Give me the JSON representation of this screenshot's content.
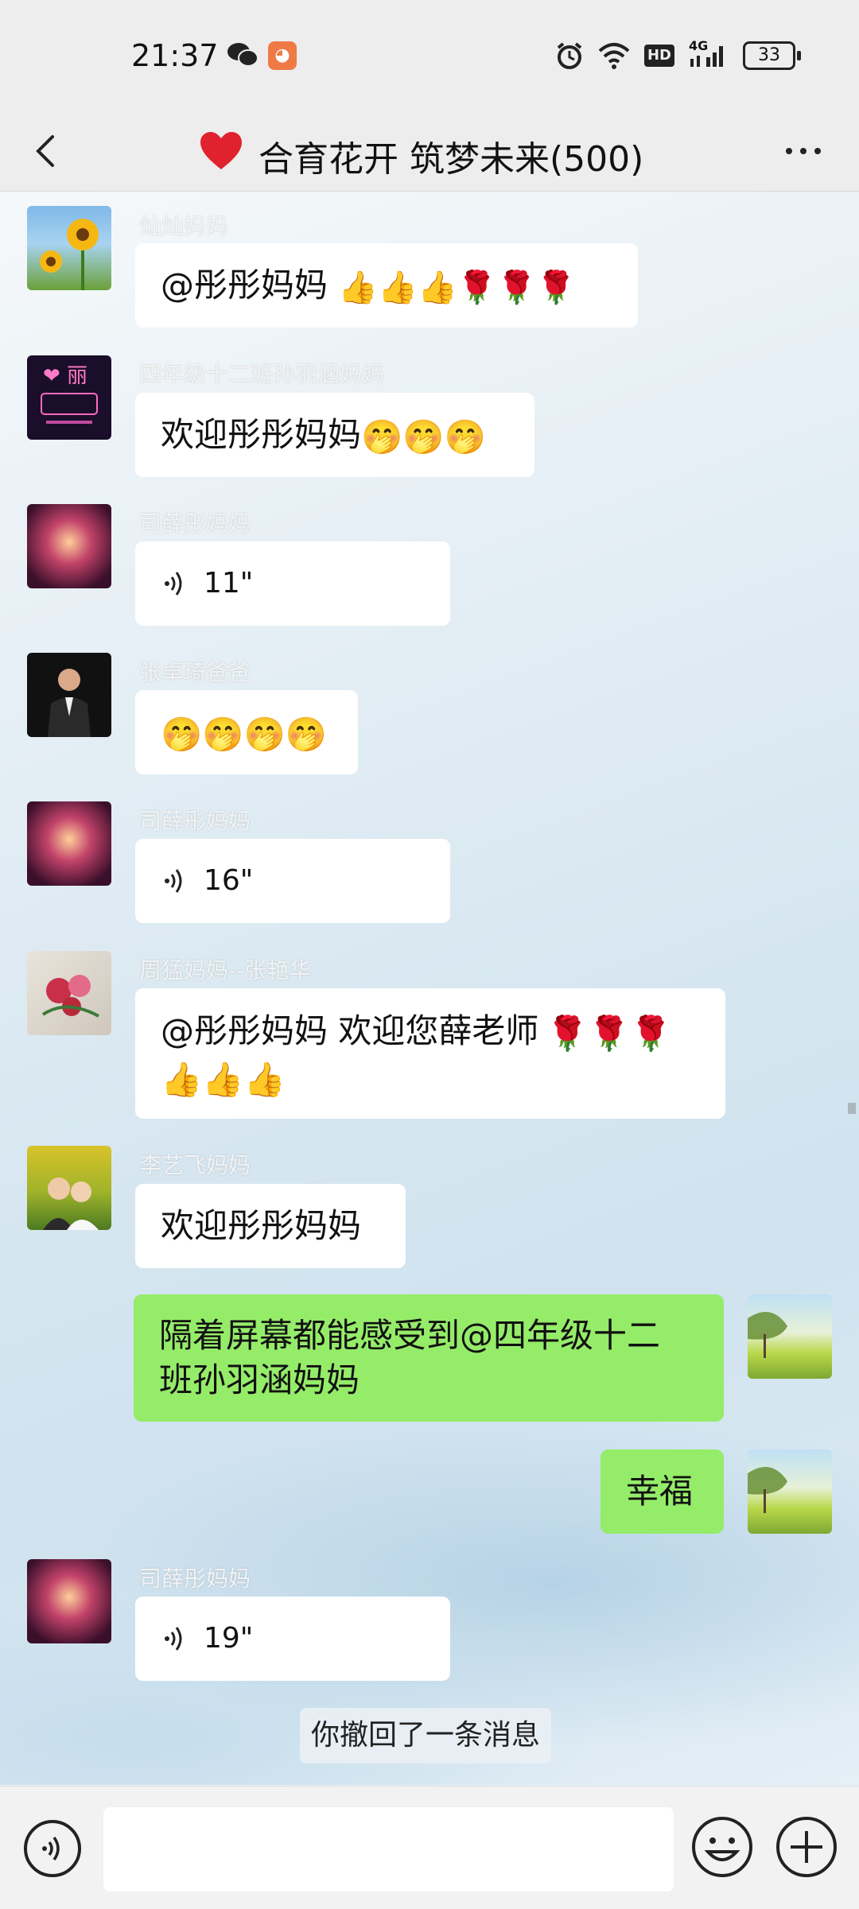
{
  "status_bar": {
    "time": "21:37",
    "battery": "33",
    "network": "4G",
    "hd": "HD"
  },
  "header": {
    "title": "合育花开 筑梦未来(500)"
  },
  "messages": [
    {
      "sender": "灿灿妈妈",
      "text": "@彤彤妈妈 ",
      "emojis": "👍👍👍🌹🌹🌹"
    },
    {
      "sender": "四年级十二班孙羽涵妈妈",
      "text": "欢迎彤彤妈妈",
      "emojis": "🤭🤭🤭"
    },
    {
      "sender": "司薛彤妈妈",
      "voice": "11\""
    },
    {
      "sender": "张卓琦爸爸",
      "emojis": "🤭🤭🤭🤭"
    },
    {
      "sender": "司薛彤妈妈",
      "voice": "16\""
    },
    {
      "sender": "周猛妈妈--张艳华",
      "text": "@彤彤妈妈  欢迎您薛老师",
      "emojis": "🌹🌹🌹",
      "emojis2": "👍👍👍"
    },
    {
      "sender": "李艺飞妈妈",
      "text": "欢迎彤彤妈妈"
    },
    {
      "sender": "me",
      "text_line1": "隔着屏幕都能感受到@四年级十二",
      "text_line2": "班孙羽涵妈妈"
    },
    {
      "sender": "me",
      "text": "幸福"
    },
    {
      "sender": "司薛彤妈妈",
      "voice": "19\""
    }
  ],
  "system_message": "你撤回了一条消息",
  "icons": {
    "back": "chevron-left-icon",
    "more": "more-dots-icon",
    "voice": "voice-icon",
    "emoji": "emoji-icon",
    "plus": "plus-icon"
  },
  "colors": {
    "my_bubble": "#95ec69",
    "other_bubble": "#ffffff"
  }
}
